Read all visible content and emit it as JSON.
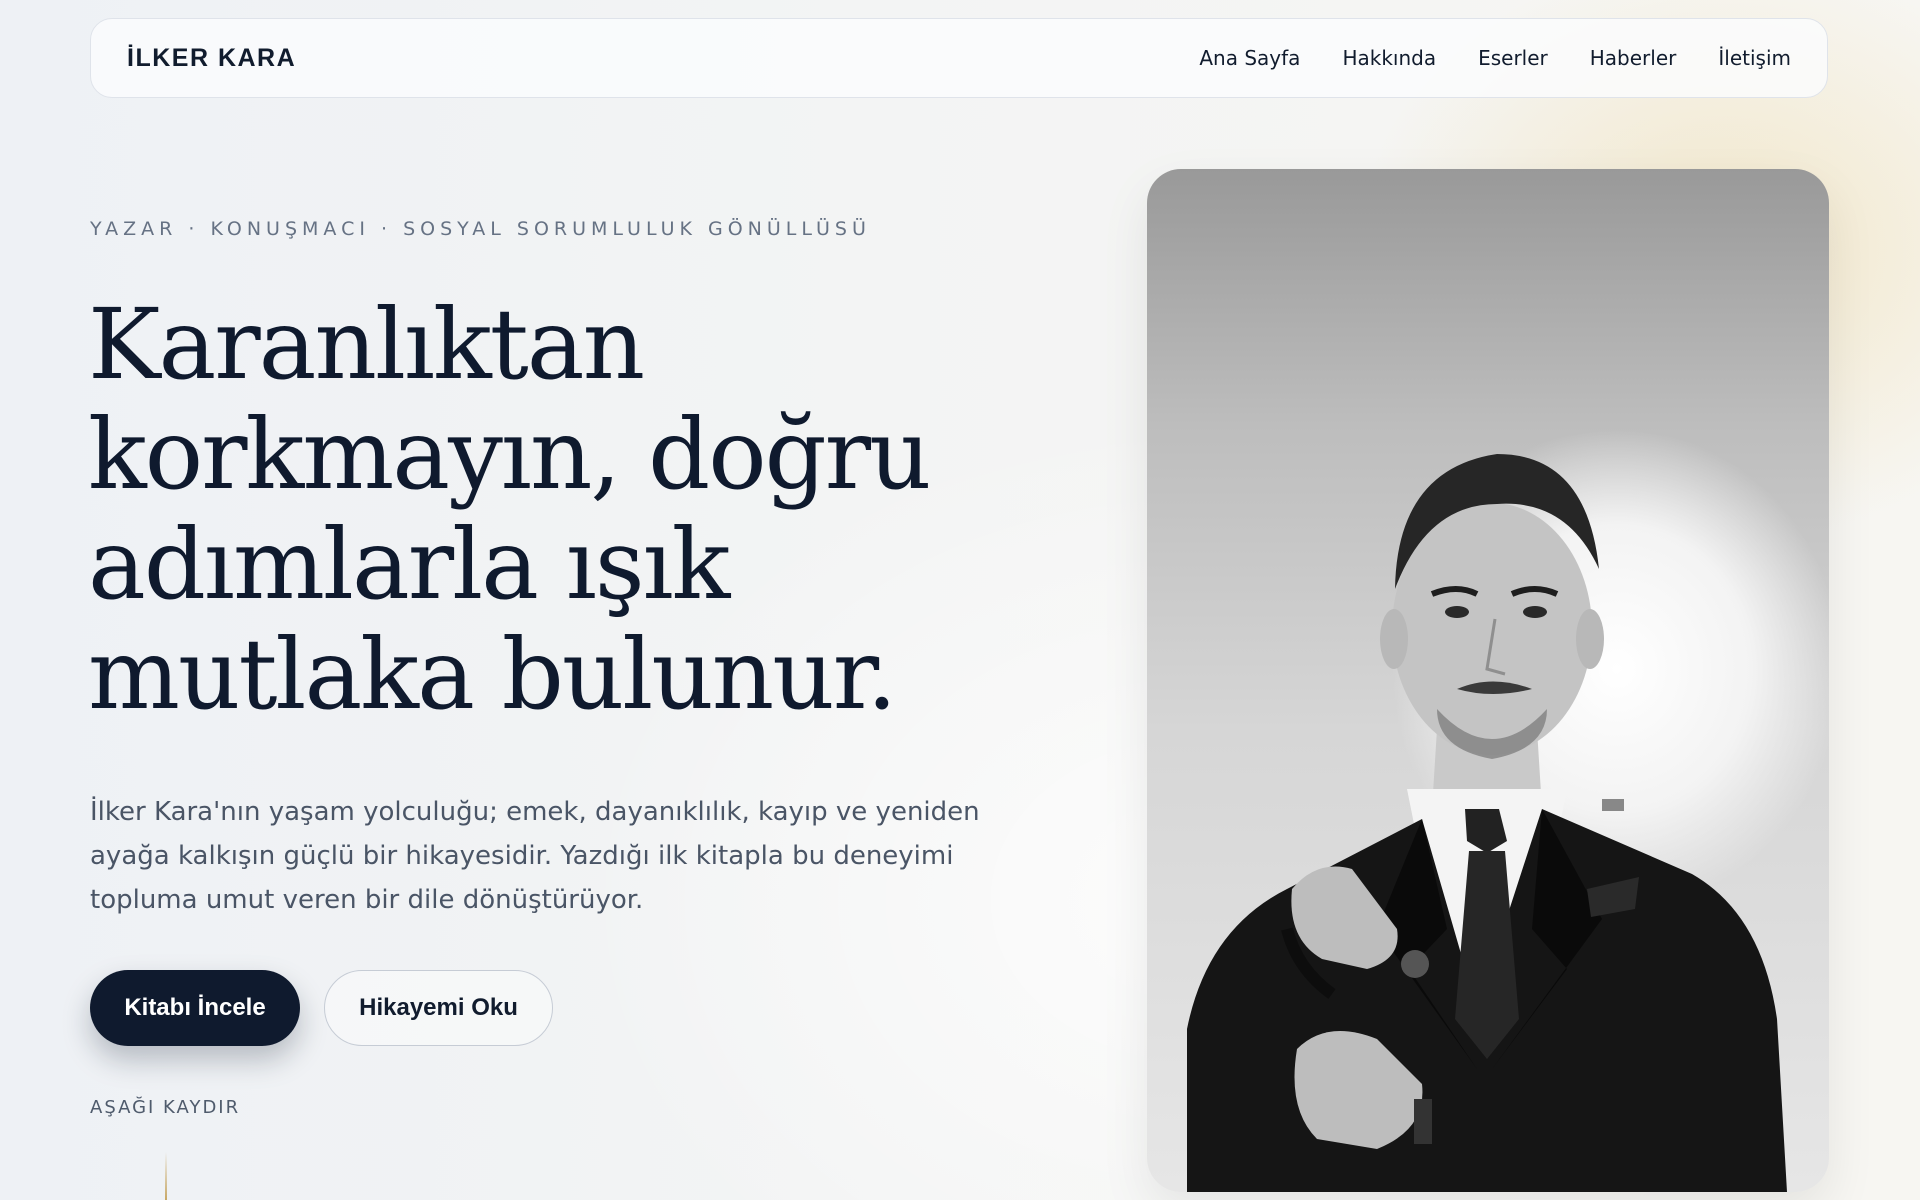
{
  "nav": {
    "brand": "İLKER KARA",
    "links": [
      "Ana Sayfa",
      "Hakkında",
      "Eserler",
      "Haberler",
      "İletişim"
    ]
  },
  "hero": {
    "eyebrow": "YAZAR · KONUŞMACI · SOSYAL SORUMLULUK GÖNÜLLÜSÜ",
    "headline_lines": [
      "Karanlıktan",
      "korkmayın, doğru",
      "adımlarla ışık",
      "mutlaka bulunur."
    ],
    "lede_lines": [
      "İlker Kara'nın yaşam yolculuğu; emek, dayanıklılık, kayıp ve yeniden",
      "ayağa kalkışın güçlü bir hikayesidir. Yazdığı ilk kitapla bu deneyimi",
      "topluma umut veren bir dile dönüştürüyor."
    ],
    "primary_button": "Kitabı İncele",
    "secondary_button": "Hikayemi Oku",
    "scroll_hint": "AŞAĞI KAYDIR"
  },
  "portrait": {
    "icon": "person-portrait"
  },
  "colors": {
    "ink": "#0f1a2e",
    "muted": "#667284",
    "accent_gold": "#c8a864"
  }
}
